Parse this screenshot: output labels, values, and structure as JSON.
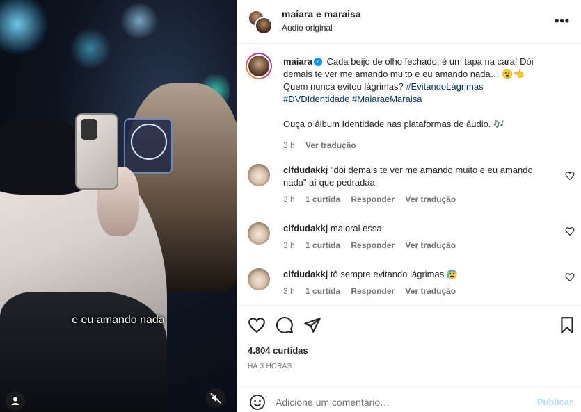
{
  "video": {
    "caption": "e eu amando nada"
  },
  "header": {
    "title": "maiara e maraisa",
    "subtitle": "Áudio original",
    "more": "•••"
  },
  "post": {
    "username": "maiara",
    "verified_mark": "✓",
    "text_line1": "Cada beijo de olho fechado, é um tapa na cara! Dói demais te ver me amando muito e eu amando nada… 😮👈",
    "text_line2": "Quem nunca evitou lágrimas?",
    "hashtags": [
      "#EvitandoLágrimas",
      "#DVDIdentidade",
      "#MaiaraeMaraisa"
    ],
    "text_line3": "Ouça o álbum Identidade nas plataformas de áudio. 🎶",
    "time": "3 h",
    "translate": "Ver tradução"
  },
  "comments": [
    {
      "username": "clfdudakkj",
      "text": "\"dói demais te ver me amando muito e eu amando nada\" aí que pedradaa",
      "time": "3 h",
      "likes": "1 curtida",
      "reply": "Responder",
      "translate": "Ver tradução"
    },
    {
      "username": "clfdudakkj",
      "text": "maioral essa",
      "time": "3 h",
      "likes": "1 curtida",
      "reply": "Responder",
      "translate": "Ver tradução"
    },
    {
      "username": "clfdudakkj",
      "text": "tô sempre evitando lágrimas 😰",
      "time": "3 h",
      "likes": "1 curtida",
      "reply": "Responder",
      "translate": "Ver tradução"
    }
  ],
  "stats": {
    "likes": "4.804 curtidas",
    "posted": "HÁ 3 HORAS"
  },
  "composer": {
    "placeholder": "Adicione um comentário…",
    "publish": "Publicar"
  },
  "icons": {
    "like": "heart-icon",
    "comment": "comment-icon",
    "share": "share-icon",
    "save": "bookmark-icon",
    "emoji": "emoji-icon",
    "more": "more-icon",
    "user": "user-icon",
    "mute": "mute-icon"
  },
  "colors": {
    "link": "#00376b",
    "verified": "#0095f6",
    "publish_disabled": "#b2dffc",
    "muted_text": "#737373"
  }
}
